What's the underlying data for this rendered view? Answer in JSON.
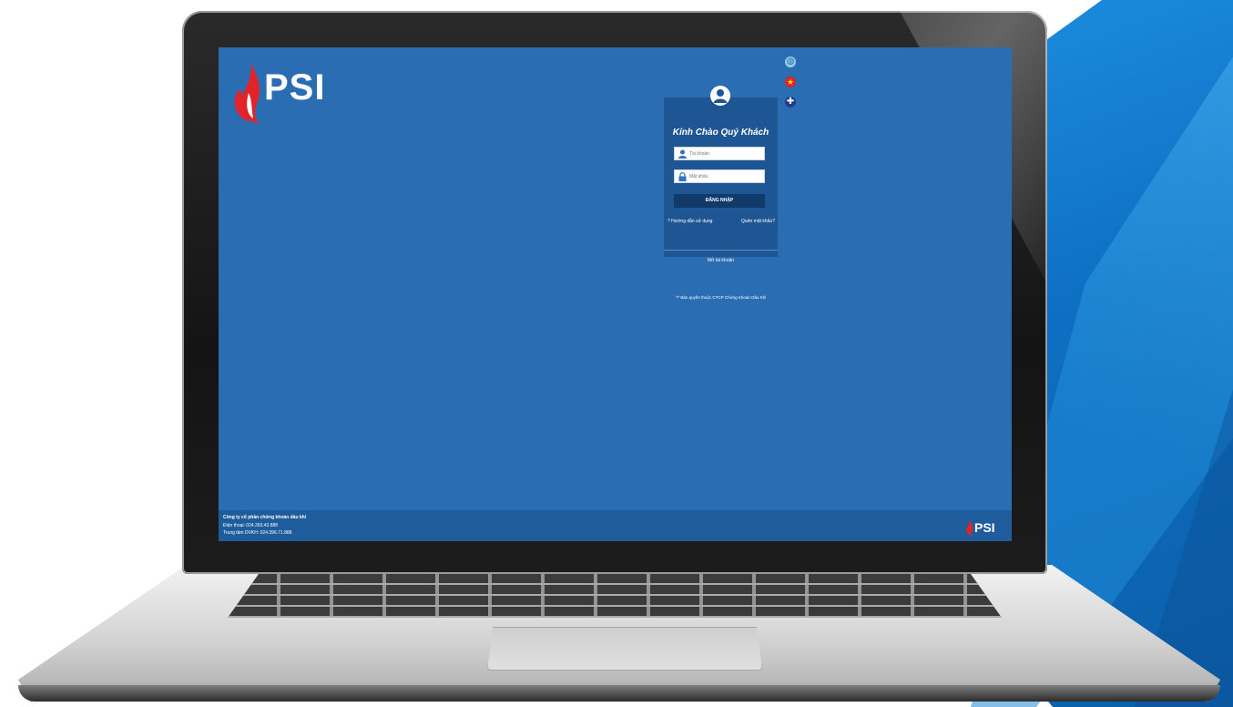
{
  "brand": {
    "logo_text": "PSI",
    "logo_subtitle": "",
    "footer_logo_text": "PSI",
    "primary_color": "#2a6db3",
    "accent_color": "#e3232a"
  },
  "language_icons": [
    "globe-icon",
    "flag-vietnam-icon",
    "flag-uk-icon"
  ],
  "login": {
    "welcome": "Kính Chào Quý Khách",
    "username_placeholder": "Tài khoản",
    "password_placeholder": "Mật khẩu",
    "login_button": "ĐĂNG NHẬP",
    "guide_link": "Hướng dẫn sử dụng",
    "forgot_link": "Quên mật khẩu?",
    "open_account": "Mở tài khoản",
    "copyright": "™ Bản quyền thuộc CTCP Chứng Khoán Dầu Khí"
  },
  "footer": {
    "company": "Công ty cổ phần chứng khoán dầu khí",
    "phone": "Điện thoại: 024.393.43.888",
    "support": "Trung tâm DVKH: 024.396.71.888"
  }
}
